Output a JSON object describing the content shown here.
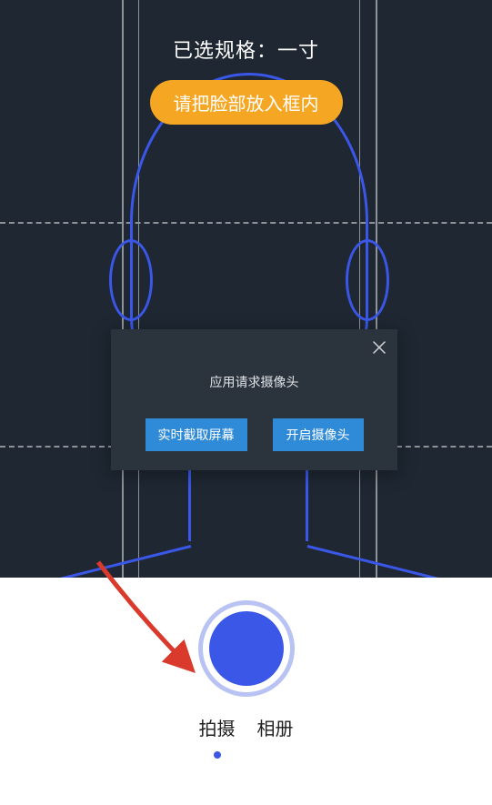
{
  "spec": {
    "label": "已选规格：一寸"
  },
  "hint": {
    "face_in_frame": "请把脸部放入框内"
  },
  "modal": {
    "title": "应用请求摄像头",
    "capture_screen": "实时截取屏幕",
    "open_camera": "开启摄像头"
  },
  "tabs": {
    "shoot": "拍摄",
    "album": "相册",
    "active": "shoot"
  },
  "colors": {
    "accent": "#3a57e8",
    "hint_bg": "#f5a623",
    "modal_btn": "#2f8ad8",
    "bg_dark": "#1e2732"
  }
}
